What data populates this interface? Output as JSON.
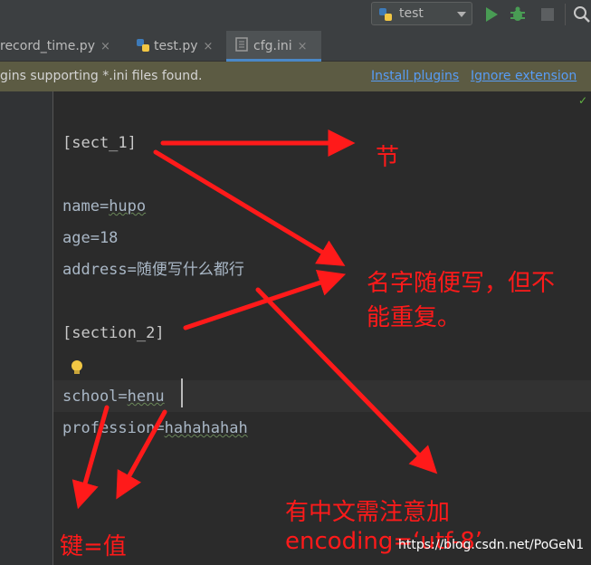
{
  "toolbar": {
    "run_config": "test"
  },
  "tabs": [
    {
      "label": "record_time.py",
      "close": "×"
    },
    {
      "label": "test.py",
      "close": "×"
    },
    {
      "label": "cfg.ini",
      "close": "×"
    }
  ],
  "notice": {
    "message": "gins supporting *.ini files found.",
    "install_link": "Install plugins",
    "ignore_link": "Ignore extension"
  },
  "code": {
    "section1": "[sect_1]",
    "name_key": "name=",
    "name_val": "hupo",
    "age": "age=18",
    "address": "address=随便写什么都行",
    "section2": "[section_2]",
    "school_key": "school=",
    "school_val": "henu",
    "profession_key": "profession=",
    "profession_val": "hahahahah"
  },
  "annotations": {
    "jie": "节",
    "name_note_1": "名字随便写，但不",
    "name_note_2": "能重复。",
    "encoding_1": "有中文需注意加",
    "encoding_2": "encoding=‘utf-8’",
    "kv": "键=值"
  },
  "watermark": "https://blog.csdn.net/PoGeN1",
  "colors": {
    "annotation_red": "#ff1a1a",
    "link_blue": "#589df6",
    "notice_bg": "#5c5b43",
    "editor_bg": "#2b2b2b"
  },
  "icons": [
    "python-icon",
    "chevron-down-icon",
    "run-icon",
    "debug-icon",
    "stop-icon",
    "search-icon",
    "ini-file-icon",
    "lightbulb-icon",
    "check-icon"
  ]
}
